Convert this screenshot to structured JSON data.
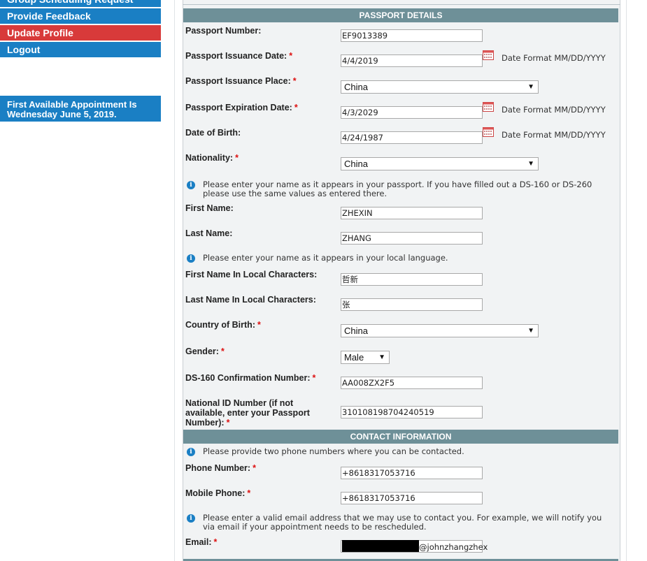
{
  "sidebar": {
    "items": [
      {
        "label": "Group Scheduling Request"
      },
      {
        "label": "Provide Feedback"
      },
      {
        "label": "Update Profile"
      },
      {
        "label": "Logout"
      }
    ],
    "appointment_notice": {
      "line1": "First Available Appointment Is",
      "line2": "Wednesday June 5, 2019."
    }
  },
  "passport": {
    "header": "PASSPORT DETAILS",
    "date_format_hint": "Date Format MM/DD/YYYY",
    "passport_number": {
      "label": "Passport Number:",
      "value": "EF9013389"
    },
    "issuance_date": {
      "label": "Passport Issuance Date:",
      "value": "4/4/2019"
    },
    "issuance_place": {
      "label": "Passport Issuance Place:",
      "value": "China"
    },
    "expiration_date": {
      "label": "Passport Expiration Date:",
      "value": "4/3/2029"
    },
    "date_of_birth": {
      "label": "Date of Birth:",
      "value": "4/24/1987"
    },
    "nationality": {
      "label": "Nationality:",
      "value": "China"
    },
    "name_info": "Please enter your name as it appears in your passport. If you have filled out a DS-160 or DS-260 please use the same values as entered there.",
    "first_name": {
      "label": "First Name:",
      "value": "ZHEXIN"
    },
    "last_name": {
      "label": "Last Name:",
      "value": "ZHANG"
    },
    "local_info": "Please enter your name as it appears in your local language.",
    "first_name_local": {
      "label": "First Name In Local Characters:",
      "value": "哲新"
    },
    "last_name_local": {
      "label": "Last Name In Local Characters:",
      "value": "张"
    },
    "country_of_birth": {
      "label": "Country of Birth:",
      "value": "China"
    },
    "gender": {
      "label": "Gender:",
      "value": "Male"
    },
    "ds160": {
      "label": "DS-160 Confirmation Number:",
      "value": "AA008ZX2F5"
    },
    "national_id": {
      "label_line1": "National ID Number (if not",
      "label_line2": "available, enter your Passport",
      "label_line3": "Number):",
      "value": "310108198704240519"
    }
  },
  "contact": {
    "header": "CONTACT INFORMATION",
    "phone_info": "Please provide two phone numbers where you can be contacted.",
    "phone": {
      "label": "Phone Number:",
      "value": "+8618317053716"
    },
    "mobile": {
      "label": "Mobile Phone:",
      "value": "+8618317053716"
    },
    "email_info": "Please enter a valid email address that we may use to contact you. For example, we will notify you via email if your appointment needs to be rescheduled.",
    "email": {
      "label": "Email:",
      "visible_value": "@johnzhangzhex"
    }
  },
  "colors": {
    "accent_blue": "#1a7fc4",
    "active_red": "#d83a3a",
    "section_header": "#6e9098",
    "required": "#dd1111"
  },
  "icons": {
    "calendar": "calendar-icon",
    "info": "info-icon",
    "dropdown": "chevron-down-icon"
  }
}
